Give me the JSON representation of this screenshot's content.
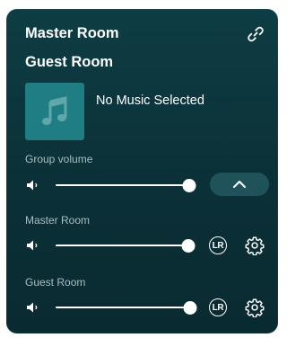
{
  "header": {
    "primary_room": "Master Room",
    "secondary_room": "Guest Room",
    "link_icon": "link-icon"
  },
  "now_playing": {
    "text": "No Music Selected",
    "art_icon": "music-note-icon"
  },
  "group_volume": {
    "label": "Group volume",
    "level": 1.0,
    "toggle_icon": "chevron-up-icon"
  },
  "rooms": [
    {
      "label": "Master Room",
      "level": 1.0,
      "channel_label": "LR",
      "settings_icon": "gear-icon"
    },
    {
      "label": "Guest Room",
      "level": 1.0,
      "channel_label": "LR",
      "settings_icon": "gear-icon"
    }
  ],
  "colors": {
    "panel": "#0b3037",
    "accent": "#1f7e83",
    "button": "#1f5359",
    "muted_text": "#a9bec1"
  }
}
